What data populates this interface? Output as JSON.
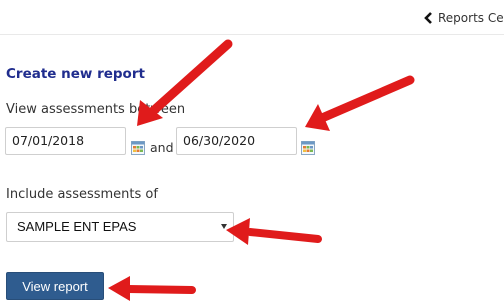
{
  "nav": {
    "back_label": "Reports Cente"
  },
  "form": {
    "title": "Create new report",
    "date_range_label": "View assessments between",
    "start_date": "07/01/2018",
    "conjunction": "and",
    "end_date": "06/30/2020",
    "include_label": "Include assessments of",
    "selected_program": "SAMPLE ENT EPAS",
    "submit_label": "View report"
  },
  "icons": {
    "back": "chevron-left-icon",
    "calendar": "calendar-icon",
    "dropdown": "dropdown-caret-icon",
    "annotation": "red-arrow-icon"
  },
  "colors": {
    "title": "#202d8e",
    "button": "#2f5c8f",
    "annotation_arrow": "#e01b1b"
  }
}
